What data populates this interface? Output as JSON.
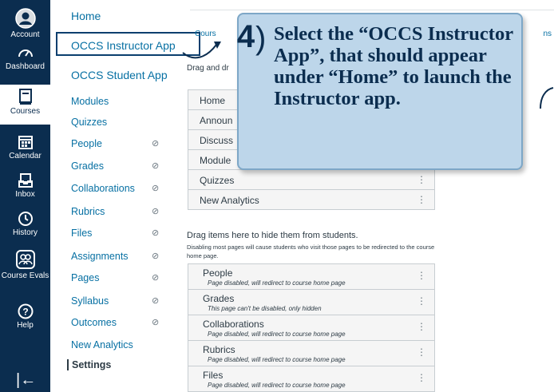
{
  "global_nav": {
    "items": [
      {
        "label": "Account",
        "icon": "account-icon"
      },
      {
        "label": "Dashboard",
        "icon": "dashboard-icon"
      },
      {
        "label": "Courses",
        "icon": "courses-icon"
      },
      {
        "label": "Calendar",
        "icon": "calendar-icon"
      },
      {
        "label": "Inbox",
        "icon": "inbox-icon"
      },
      {
        "label": "History",
        "icon": "history-icon"
      },
      {
        "label": "Course Evals",
        "icon": "course-evals-icon"
      },
      {
        "label": "Help",
        "icon": "help-icon"
      }
    ],
    "collapse_glyph": "|←"
  },
  "course_nav": {
    "items": [
      {
        "label": "Home"
      },
      {
        "label": "OCCS Instructor App"
      },
      {
        "label": "OCCS Student App"
      },
      {
        "label": "Modules"
      },
      {
        "label": "Quizzes"
      },
      {
        "label": "People",
        "hidden": true
      },
      {
        "label": "Grades",
        "hidden": true
      },
      {
        "label": "Collaborations",
        "hidden": true
      },
      {
        "label": "Rubrics",
        "hidden": true
      },
      {
        "label": "Files",
        "hidden": true
      },
      {
        "label": "Assignments",
        "hidden": true
      },
      {
        "label": "Pages",
        "hidden": true
      },
      {
        "label": "Syllabus",
        "hidden": true
      },
      {
        "label": "Outcomes",
        "hidden": true
      },
      {
        "label": "New Analytics"
      },
      {
        "label": "Settings"
      }
    ],
    "hidden_icon": "eye-slash-icon"
  },
  "main": {
    "top_course_label": "Cours",
    "top_right_label": "ns",
    "drag_text": "Drag and dr",
    "visible_items": [
      "Home",
      "Announ",
      "Discuss",
      "Module",
      "Quizzes",
      "New Analytics"
    ],
    "hide_title": "Drag items here to hide them from students.",
    "hide_subtitle": "Disabling most pages will cause students who visit those pages to be redirected to the course home page.",
    "hidden_items": [
      {
        "label": "People",
        "note": "Page disabled, will redirect to course home page"
      },
      {
        "label": "Grades",
        "note": "This page can't be disabled, only hidden"
      },
      {
        "label": "Collaborations",
        "note": "Page disabled, will redirect to course home page"
      },
      {
        "label": "Rubrics",
        "note": "Page disabled, will redirect to course home page"
      },
      {
        "label": "Files",
        "note": "Page disabled, will redirect to course home page"
      }
    ],
    "kebab_glyph": "⋮"
  },
  "callout": {
    "step_number": "4",
    "text": "Select the “OCCS Instructor App”, that should appear under “Home” to launch the Instructor app."
  },
  "colors": {
    "nav_bg": "#0b2d4f",
    "link": "#0770a3",
    "callout_bg": "#bdd6ea",
    "callout_text": "#0b2d4f"
  }
}
